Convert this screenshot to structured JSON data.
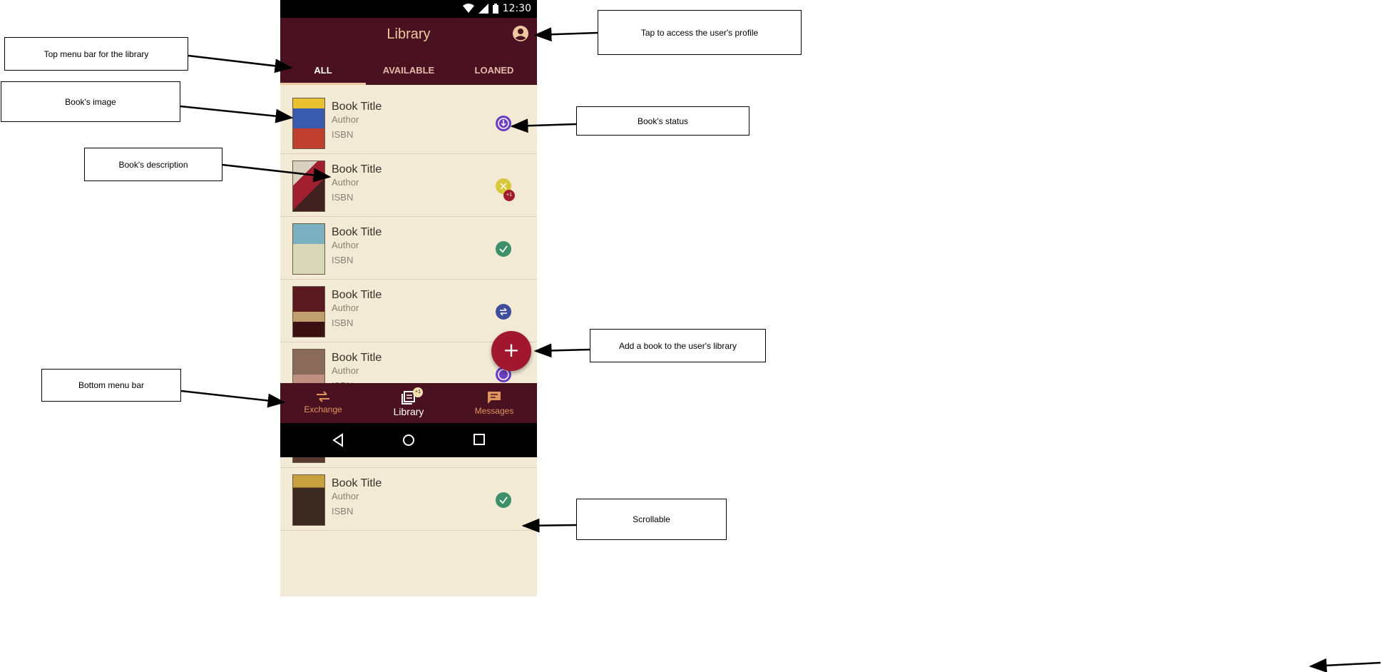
{
  "status_bar": {
    "time": "12:30",
    "icons": [
      "wifi-icon",
      "signal-icon",
      "battery-icon"
    ]
  },
  "app_bar": {
    "title": "Library",
    "profile_icon": "account-circle-icon"
  },
  "tabs": [
    {
      "label": "ALL",
      "active": true
    },
    {
      "label": "AVAILABLE",
      "active": false
    },
    {
      "label": "LOANED",
      "active": false
    }
  ],
  "books": [
    {
      "title": "Book Title",
      "author": "Author",
      "isbn": "ISBN",
      "status": "requested",
      "status_color": "#6b3fc0"
    },
    {
      "title": "Book Title",
      "author": "Author",
      "isbn": "ISBN",
      "status": "pending",
      "status_color": "#d6c83a",
      "badge": "+1"
    },
    {
      "title": "Book Title",
      "author": "Author",
      "isbn": "ISBN",
      "status": "available",
      "status_color": "#3e8f6a"
    },
    {
      "title": "Book Title",
      "author": "Author",
      "isbn": "ISBN",
      "status": "exchanged",
      "status_color": "#3f4e9a"
    },
    {
      "title": "Book Title",
      "author": "Author",
      "isbn": "ISBN",
      "status": "requested",
      "status_color": "#6b3fc0"
    },
    {
      "title": "Book Title",
      "author": "Author",
      "isbn": "ISBN",
      "status": "available",
      "status_color": "#3e8f6a"
    }
  ],
  "fab": {
    "icon": "add-icon",
    "label": "+"
  },
  "bottom_nav": [
    {
      "label": "Exchange",
      "icon": "exchange-icon",
      "active": false
    },
    {
      "label": "Library",
      "icon": "library-icon",
      "active": true,
      "badge": "+1"
    },
    {
      "label": "Messages",
      "icon": "message-icon",
      "active": false
    }
  ],
  "annotations": {
    "top_menu": "Top menu bar for the library",
    "book_image": "Book's image",
    "book_description": "Book's description",
    "bottom_menu": "Bottom menu bar",
    "profile": "Tap to access the user's profile",
    "status": "Book's status",
    "add_book": "Add a book to the user's library",
    "scrollable": "Scrollable"
  },
  "colors": {
    "primary": "#4a1120",
    "accent": "#a0172e",
    "background": "#f3ead6",
    "title_accent": "#f0c9a0"
  }
}
